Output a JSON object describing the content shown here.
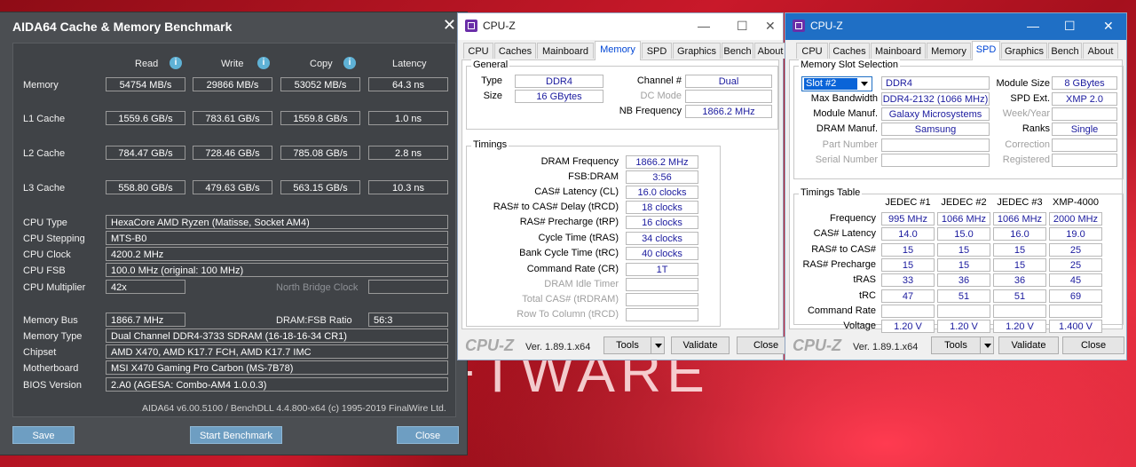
{
  "background": {
    "text": "FTWARE"
  },
  "aida": {
    "title": "AIDA64 Cache & Memory Benchmark",
    "headers": {
      "read": "Read",
      "write": "Write",
      "copy": "Copy",
      "latency": "Latency"
    },
    "rows": [
      {
        "label": "Memory",
        "read": "54754 MB/s",
        "write": "29866 MB/s",
        "copy": "53052 MB/s",
        "latency": "64.3 ns"
      },
      {
        "label": "L1 Cache",
        "read": "1559.6 GB/s",
        "write": "783.61 GB/s",
        "copy": "1559.8 GB/s",
        "latency": "1.0 ns"
      },
      {
        "label": "L2 Cache",
        "read": "784.47 GB/s",
        "write": "728.46 GB/s",
        "copy": "785.08 GB/s",
        "latency": "2.8 ns"
      },
      {
        "label": "L3 Cache",
        "read": "558.80 GB/s",
        "write": "479.63 GB/s",
        "copy": "563.15 GB/s",
        "latency": "10.3 ns"
      }
    ],
    "cpu": {
      "type_label": "CPU Type",
      "type": "HexaCore AMD Ryzen  (Matisse, Socket AM4)",
      "stepping_label": "CPU Stepping",
      "stepping": "MTS-B0",
      "clock_label": "CPU Clock",
      "clock": "4200.2 MHz",
      "fsb_label": "CPU FSB",
      "fsb": "100.0 MHz  (original: 100 MHz)",
      "mult_label": "CPU Multiplier",
      "mult": "42x",
      "nb_label": "North Bridge Clock",
      "nb": ""
    },
    "mem": {
      "bus_label": "Memory Bus",
      "bus": "1866.7 MHz",
      "ratio_label": "DRAM:FSB Ratio",
      "ratio": "56:3",
      "type_label": "Memory Type",
      "type": "Dual Channel DDR4-3733 SDRAM  (16-18-16-34 CR1)",
      "chipset_label": "Chipset",
      "chipset": "AMD X470, AMD K17.7 FCH, AMD K17.7 IMC",
      "mobo_label": "Motherboard",
      "mobo": "MSI X470 Gaming Pro Carbon (MS-7B78)",
      "bios_label": "BIOS Version",
      "bios": "2.A0  (AGESA: Combo-AM4 1.0.0.3)"
    },
    "footer": "AIDA64 v6.00.5100 / BenchDLL 4.4.800-x64  (c) 1995-2019 FinalWire Ltd.",
    "buttons": {
      "save": "Save",
      "start": "Start Benchmark",
      "close": "Close"
    }
  },
  "cpuz_mem": {
    "title": "CPU-Z",
    "tabs": [
      "CPU",
      "Caches",
      "Mainboard",
      "Memory",
      "SPD",
      "Graphics",
      "Bench",
      "About"
    ],
    "selected_tab": "Memory",
    "general": {
      "title": "General",
      "type_label": "Type",
      "type": "DDR4",
      "size_label": "Size",
      "size": "16 GBytes",
      "channel_label": "Channel #",
      "channel": "Dual",
      "dc_label": "DC Mode",
      "dc": "",
      "nb_label": "NB Frequency",
      "nb": "1866.2 MHz"
    },
    "timings": {
      "title": "Timings",
      "rows": [
        {
          "label": "DRAM Frequency",
          "value": "1866.2 MHz",
          "dim": false
        },
        {
          "label": "FSB:DRAM",
          "value": "3:56",
          "dim": false
        },
        {
          "label": "CAS# Latency (CL)",
          "value": "16.0 clocks",
          "dim": false
        },
        {
          "label": "RAS# to CAS# Delay (tRCD)",
          "value": "18 clocks",
          "dim": false
        },
        {
          "label": "RAS# Precharge (tRP)",
          "value": "16 clocks",
          "dim": false
        },
        {
          "label": "Cycle Time (tRAS)",
          "value": "34 clocks",
          "dim": false
        },
        {
          "label": "Bank Cycle Time (tRC)",
          "value": "40 clocks",
          "dim": false
        },
        {
          "label": "Command Rate (CR)",
          "value": "1T",
          "dim": false
        },
        {
          "label": "DRAM Idle Timer",
          "value": "",
          "dim": true
        },
        {
          "label": "Total CAS# (tRDRAM)",
          "value": "",
          "dim": true
        },
        {
          "label": "Row To Column (tRCD)",
          "value": "",
          "dim": true
        }
      ]
    },
    "footer": {
      "logo": "CPU-Z",
      "version": "Ver. 1.89.1.x64",
      "tools": "Tools",
      "validate": "Validate",
      "close": "Close"
    }
  },
  "cpuz_spd": {
    "title": "CPU-Z",
    "tabs": [
      "CPU",
      "Caches",
      "Mainboard",
      "Memory",
      "SPD",
      "Graphics",
      "Bench",
      "About"
    ],
    "selected_tab": "SPD",
    "slot": {
      "title": "Memory Slot Selection",
      "selected": "Slot #2",
      "type": "DDR4",
      "module_size_label": "Module Size",
      "module_size": "8 GBytes",
      "max_bw_label": "Max Bandwidth",
      "max_bw": "DDR4-2132 (1066 MHz)",
      "spd_ext_label": "SPD Ext.",
      "spd_ext": "XMP 2.0",
      "module_manuf_label": "Module Manuf.",
      "module_manuf": "Galaxy Microsystems Ltd.",
      "week_label": "Week/Year",
      "week": "",
      "dram_manuf_label": "DRAM Manuf.",
      "dram_manuf": "Samsung",
      "ranks_label": "Ranks",
      "ranks": "Single",
      "part_label": "Part Number",
      "part": "",
      "correction_label": "Correction",
      "correction": "",
      "serial_label": "Serial Number",
      "serial": "",
      "registered_label": "Registered",
      "registered": ""
    },
    "timings": {
      "title": "Timings Table",
      "columns": [
        "JEDEC #1",
        "JEDEC #2",
        "JEDEC #3",
        "XMP-4000"
      ],
      "rows": [
        {
          "label": "Frequency",
          "values": [
            "995 MHz",
            "1066 MHz",
            "1066 MHz",
            "2000 MHz"
          ]
        },
        {
          "label": "CAS# Latency",
          "values": [
            "14.0",
            "15.0",
            "16.0",
            "19.0"
          ]
        },
        {
          "label": "RAS# to CAS#",
          "values": [
            "15",
            "15",
            "15",
            "25"
          ]
        },
        {
          "label": "RAS# Precharge",
          "values": [
            "15",
            "15",
            "15",
            "25"
          ]
        },
        {
          "label": "tRAS",
          "values": [
            "33",
            "36",
            "36",
            "45"
          ]
        },
        {
          "label": "tRC",
          "values": [
            "47",
            "51",
            "51",
            "69"
          ]
        },
        {
          "label": "Command Rate",
          "values": [
            "",
            "",
            "",
            ""
          ]
        },
        {
          "label": "Voltage",
          "values": [
            "1.20 V",
            "1.20 V",
            "1.20 V",
            "1.400 V"
          ]
        }
      ]
    },
    "footer": {
      "logo": "CPU-Z",
      "version": "Ver. 1.89.1.x64",
      "tools": "Tools",
      "validate": "Validate",
      "close": "Close"
    }
  }
}
